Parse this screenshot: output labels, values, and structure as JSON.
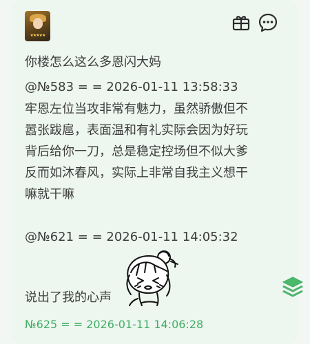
{
  "post": {
    "line1": "你楼怎么这么多恩闪大妈",
    "quote1": "@№583 = = 2026-01-11 13:58:33",
    "body": [
      "牢恩左位当攻非常有魅力，虽然骄傲但不",
      "嚣张跋扈，表面温和有礼实际会因为好玩",
      "背后给你一刀，总是稳定控场但不似大爹",
      "反而如沐春风，实际上非常自我主义想干",
      "嘛就干嘛"
    ],
    "quote2": "@№621 = = 2026-01-11 14:05:32",
    "final": "说出了我的心声",
    "footer": "№625 = = 2026-01-11 14:06:28"
  },
  "icons": {
    "avatar": "avatar",
    "gift": "gift-icon",
    "chat": "chat-bubble-icon",
    "layers": "layers-icon",
    "sticker": "sticker-image"
  },
  "colors": {
    "text": "#3d3d3d",
    "accent": "#3fae63",
    "card_bg": "#edf6ef"
  }
}
